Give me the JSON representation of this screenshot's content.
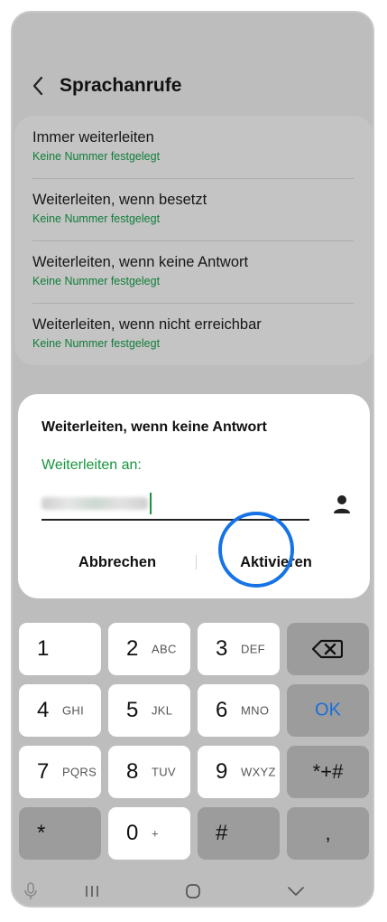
{
  "header": {
    "title": "Sprachanrufe"
  },
  "settings_list": [
    {
      "label": "Immer weiterleiten",
      "sub": "Keine Nummer festgelegt"
    },
    {
      "label": "Weiterleiten, wenn besetzt",
      "sub": "Keine Nummer festgelegt"
    },
    {
      "label": "Weiterleiten, wenn keine Antwort",
      "sub": "Keine Nummer festgelegt"
    },
    {
      "label": "Weiterleiten, wenn nicht erreichbar",
      "sub": "Keine Nummer festgelegt"
    }
  ],
  "dialog": {
    "title": "Weiterleiten, wenn keine Antwort",
    "field_label": "Weiterleiten an:",
    "cancel_label": "Abbrechen",
    "activate_label": "Aktivieren"
  },
  "keypad": {
    "k1": "1",
    "k2": "2",
    "k2_letters": "ABC",
    "k3": "3",
    "k3_letters": "DEF",
    "k4": "4",
    "k4_letters": "GHI",
    "k5": "5",
    "k5_letters": "JKL",
    "k6": "6",
    "k6_letters": "MNO",
    "k7": "7",
    "k7_letters": "PQRS",
    "k8": "8",
    "k8_letters": "TUV",
    "k9": "9",
    "k9_letters": "WXYZ",
    "k0": "0",
    "k0_sub": "+",
    "ok": "OK",
    "star": "*",
    "hash": "#",
    "star_plus_hash": "*+#",
    "comma": ","
  },
  "colors": {
    "accent_green": "#15963f",
    "highlight_blue": "#1673e6",
    "ok_blue": "#1a6fd8"
  }
}
